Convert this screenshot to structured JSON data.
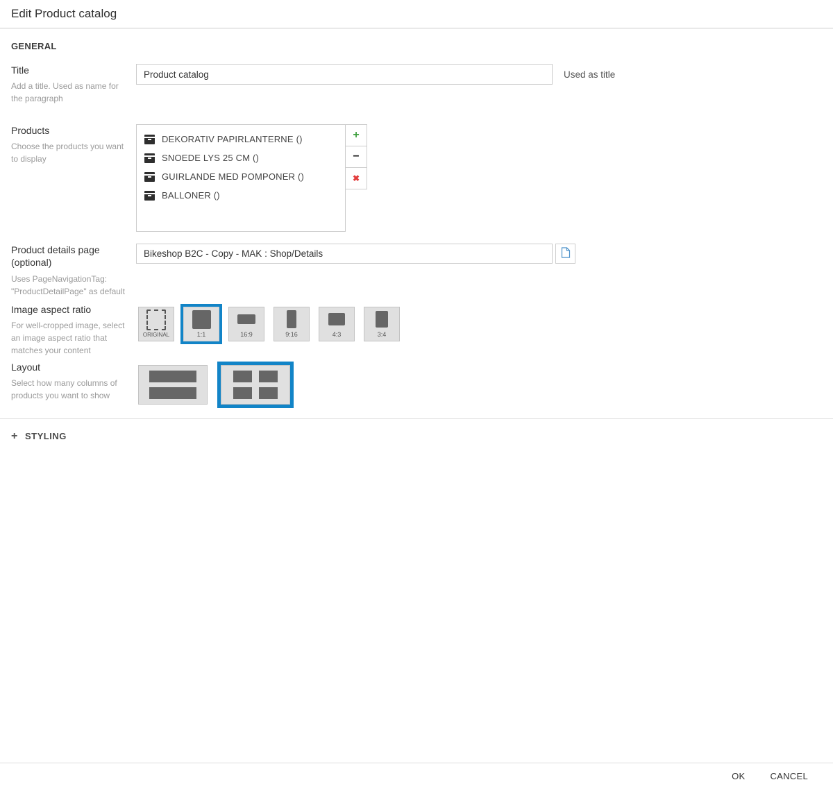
{
  "header": {
    "title": "Edit Product catalog"
  },
  "general": {
    "heading": "GENERAL"
  },
  "fields": {
    "title": {
      "label": "Title",
      "help": "Add a title. Used as name for the paragraph",
      "value": "Product catalog",
      "note": "Used as title"
    },
    "products": {
      "label": "Products",
      "help": "Choose the products you want to display",
      "items": [
        {
          "name": "DEKORATIV PAPIRLANTERNE ()"
        },
        {
          "name": "SNOEDE LYS 25 CM ()"
        },
        {
          "name": "GUIRLANDE MED POMPONER ()"
        },
        {
          "name": "BALLONER ()"
        }
      ],
      "buttons": {
        "add": "+",
        "remove": "−",
        "delete": "✖"
      }
    },
    "details_page": {
      "label": "Product details page (optional)",
      "help": "Uses PageNavigationTag: \"ProductDetailPage\" as default",
      "value": "Bikeshop B2C - Copy - MAK : Shop/Details"
    },
    "aspect_ratio": {
      "label": "Image aspect ratio",
      "help": "For well-cropped image, select an image aspect ratio that matches your content",
      "options": [
        {
          "id": "original",
          "label": "ORIGINAL",
          "selected": false
        },
        {
          "id": "1:1",
          "label": "1:1",
          "selected": true
        },
        {
          "id": "16:9",
          "label": "16:9",
          "selected": false
        },
        {
          "id": "9:16",
          "label": "9:16",
          "selected": false
        },
        {
          "id": "4:3",
          "label": "4:3",
          "selected": false
        },
        {
          "id": "3:4",
          "label": "3:4",
          "selected": false
        }
      ]
    },
    "layout": {
      "label": "Layout",
      "help": "Select how many columns of products you want to show",
      "options": [
        {
          "id": "one-column",
          "selected": false
        },
        {
          "id": "two-columns",
          "selected": true
        }
      ]
    }
  },
  "styling_section": {
    "expand_icon": "+",
    "label": "STYLING"
  },
  "footer": {
    "ok": "OK",
    "cancel": "CANCEL"
  },
  "colors": {
    "accent_blue": "#1284c7",
    "add_green": "#3fa13f",
    "delete_red": "#e23b3b",
    "tile_bg": "#e0e0e0",
    "tile_shape": "#666666",
    "border": "#cccccc",
    "help_text": "#9a9a9a"
  }
}
